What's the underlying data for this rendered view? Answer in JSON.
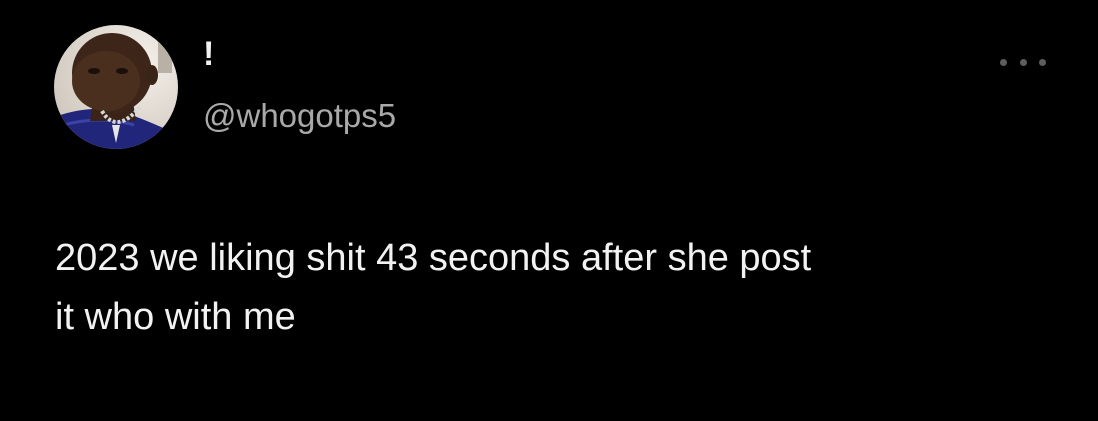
{
  "tweet": {
    "display_name": "!",
    "handle": "@whogotps5",
    "more_icon": "more-horizontal-icon",
    "text_line1": "2023 we liking shit 43 seconds after she post",
    "text_line2": "it who with me"
  },
  "colors": {
    "background": "#000000",
    "primary_text": "#f2f2f2",
    "secondary_text": "#a9a9a9",
    "icon": "#5e5e5e"
  }
}
